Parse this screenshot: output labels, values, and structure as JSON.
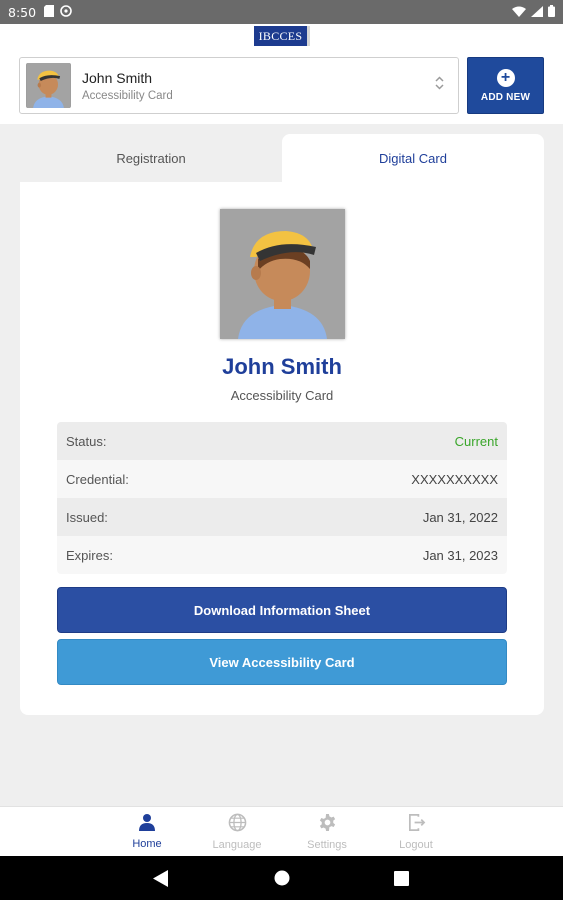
{
  "status_bar": {
    "time": "8:50"
  },
  "header": {
    "logo_text": "IBCCES",
    "profile_select": {
      "name": "John Smith",
      "subtitle": "Accessibility Card"
    },
    "add_new_label": "ADD NEW"
  },
  "tabs": [
    {
      "label": "Registration",
      "active": false
    },
    {
      "label": "Digital Card",
      "active": true
    }
  ],
  "card": {
    "name": "John Smith",
    "subtitle": "Accessibility Card",
    "rows": [
      {
        "label": "Status:",
        "value": "Current"
      },
      {
        "label": "Credential:",
        "value": "XXXXXXXXXX"
      },
      {
        "label": "Issued:",
        "value": "Jan 31, 2022"
      },
      {
        "label": "Expires:",
        "value": "Jan 31, 2023"
      }
    ],
    "download_button": "Download Information Sheet",
    "view_button": "View Accessibility Card"
  },
  "bottom_nav": [
    {
      "label": "Home",
      "icon": "person-icon",
      "active": true
    },
    {
      "label": "Language",
      "icon": "globe-icon",
      "active": false
    },
    {
      "label": "Settings",
      "icon": "gear-icon",
      "active": false
    },
    {
      "label": "Logout",
      "icon": "logout-icon",
      "active": false
    }
  ],
  "colors": {
    "brand_blue": "#1f3f9a",
    "button_dark": "#2b4fa3",
    "button_light": "#3f9ad6",
    "status_current": "#3aa62a"
  }
}
